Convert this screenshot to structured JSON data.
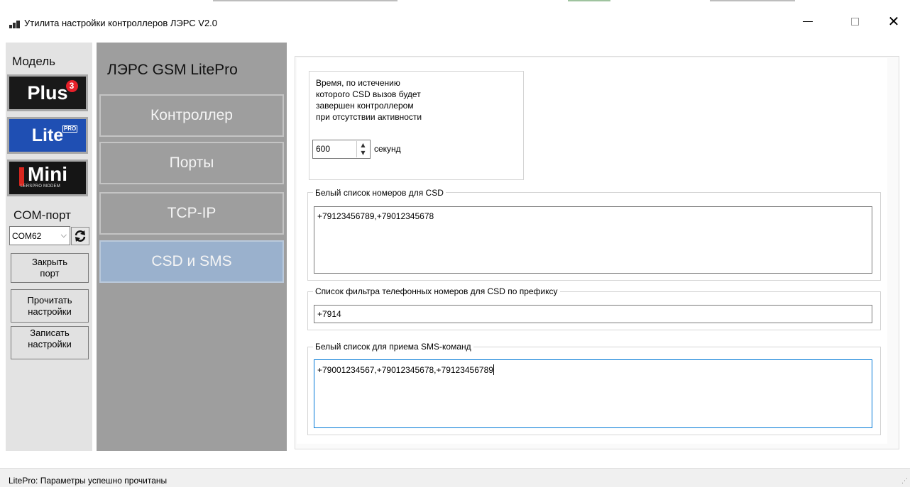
{
  "window": {
    "title": "Утилита настройки контроллеров ЛЭРС V2.0",
    "controls": {
      "minimize": "—",
      "close": "✕"
    }
  },
  "sidebar": {
    "model_label": "Модель",
    "models": [
      {
        "name": "Plus",
        "badge": "3"
      },
      {
        "name": "Lite",
        "badge": "PRO"
      },
      {
        "name": "Mini",
        "badge": "LERSPRO MODEM"
      }
    ],
    "com_label": "COM-порт",
    "com_value": "COM62",
    "buttons": {
      "close_port": [
        "Закрыть",
        "порт"
      ],
      "read_settings": [
        "Прочитать",
        "настройки"
      ],
      "write_settings": [
        "Записать",
        "настройки"
      ]
    }
  },
  "nav": {
    "device_title": "ЛЭРС GSM LitePro",
    "items": [
      {
        "label": "Контроллер",
        "active": false
      },
      {
        "label": "Порты",
        "active": false
      },
      {
        "label": "TCP-IP",
        "active": false
      },
      {
        "label": "CSD и SMS",
        "active": true
      }
    ]
  },
  "content": {
    "csd_timeout": {
      "lines": [
        "Время, по истечению",
        "которого CSD вызов будет",
        "завершен контроллером",
        "при отсутствии активности"
      ],
      "value": "600",
      "unit": "секунд"
    },
    "csd_whitelist": {
      "label": "Белый список номеров для CSD",
      "value": "+79123456789,+79012345678"
    },
    "csd_prefix_filter": {
      "label": "Список фильтра телефонных номеров для CSD по префиксу",
      "value": "+7914"
    },
    "sms_whitelist": {
      "label": "Белый список для приема SMS-команд",
      "value": "+79001234567,+79012345678,+79123456789"
    }
  },
  "status": {
    "text": "LitePro: Параметры успешно прочитаны"
  },
  "colors": {
    "nav_bg": "#9e9e9e",
    "nav_active": "#9ab1cd",
    "lite_blue": "#1f4fb3",
    "plus_badge": "#e8202a",
    "focus_border": "#0078d7"
  }
}
